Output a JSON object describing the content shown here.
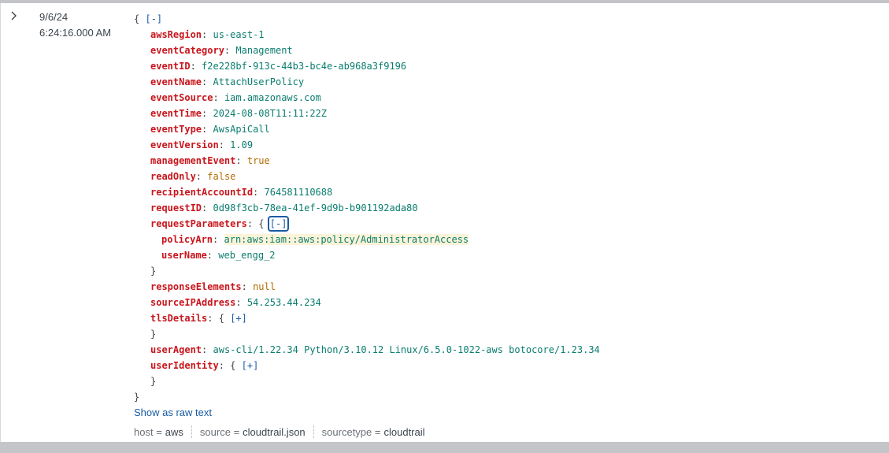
{
  "event_row": {
    "expand_icon": "chevron-right-icon",
    "date": "9/6/24",
    "time": "6:24:16.000 AM"
  },
  "event": {
    "open_brace": "{",
    "close_brace": "}",
    "collapse_toggle": "[-]",
    "expand_toggle": "[+]",
    "separator": ":",
    "fields": {
      "awsRegion": {
        "key": "awsRegion",
        "value": "us-east-1"
      },
      "eventCategory": {
        "key": "eventCategory",
        "value": "Management"
      },
      "eventID": {
        "key": "eventID",
        "value": "f2e228bf-913c-44b3-bc4e-ab968a3f9196"
      },
      "eventName": {
        "key": "eventName",
        "value": "AttachUserPolicy"
      },
      "eventSource": {
        "key": "eventSource",
        "value": "iam.amazonaws.com"
      },
      "eventTime": {
        "key": "eventTime",
        "value": "2024-08-08T11:11:22Z"
      },
      "eventType": {
        "key": "eventType",
        "value": "AwsApiCall"
      },
      "eventVersion": {
        "key": "eventVersion",
        "value": "1.09"
      },
      "managementEvent": {
        "key": "managementEvent",
        "value": "true"
      },
      "readOnly": {
        "key": "readOnly",
        "value": "false"
      },
      "recipientAccountId": {
        "key": "recipientAccountId",
        "value": "764581110688"
      },
      "requestID": {
        "key": "requestID",
        "value": "0d98f3cb-78ea-41ef-9d9b-b901192ada80"
      },
      "requestParameters": {
        "key": "requestParameters",
        "policyArn": {
          "key": "policyArn",
          "value": "arn:aws:iam::aws:policy/AdministratorAccess"
        },
        "userName": {
          "key": "userName",
          "value": "web_engg_2"
        }
      },
      "responseElements": {
        "key": "responseElements",
        "value": "null"
      },
      "sourceIPAddress": {
        "key": "sourceIPAddress",
        "value": "54.253.44.234"
      },
      "tlsDetails": {
        "key": "tlsDetails"
      },
      "userAgent": {
        "key": "userAgent",
        "value": "aws-cli/1.22.34 Python/3.10.12 Linux/6.5.0-1022-aws botocore/1.23.34"
      },
      "userIdentity": {
        "key": "userIdentity"
      }
    }
  },
  "show_raw_label": "Show as raw text",
  "meta_fields": [
    {
      "name": "host",
      "eq": " =",
      "value": "aws"
    },
    {
      "name": "source",
      "eq": " =",
      "value": "cloudtrail.json"
    },
    {
      "name": "sourcetype",
      "eq": " =",
      "value": "cloudtrail"
    }
  ],
  "colors": {
    "key": "#c8161d",
    "string": "#0a7d6e",
    "boolean": "#b36b00",
    "link": "#1a5ba3",
    "highlight": "#fcf4d8"
  }
}
